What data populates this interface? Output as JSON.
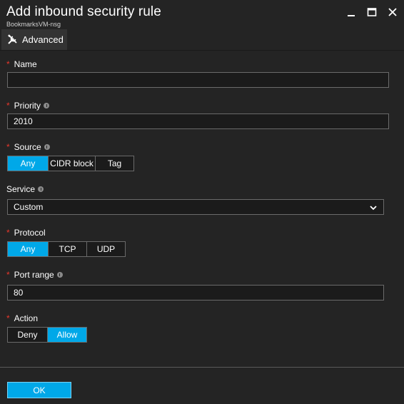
{
  "header": {
    "title": "Add inbound security rule",
    "subtitle": "BookmarksVM-nsg"
  },
  "toolbar": {
    "advanced_label": "Advanced"
  },
  "form": {
    "name": {
      "label": "Name",
      "value": ""
    },
    "priority": {
      "label": "Priority",
      "value": "2010"
    },
    "source": {
      "label": "Source",
      "options": [
        "Any",
        "CIDR block",
        "Tag"
      ],
      "selected": "Any"
    },
    "service": {
      "label": "Service",
      "value": "Custom"
    },
    "protocol": {
      "label": "Protocol",
      "options": [
        "Any",
        "TCP",
        "UDP"
      ],
      "selected": "Any"
    },
    "port_range": {
      "label": "Port range",
      "value": "80"
    },
    "action": {
      "label": "Action",
      "options": [
        "Deny",
        "Allow"
      ],
      "selected": "Allow"
    }
  },
  "footer": {
    "ok_label": "OK"
  },
  "colors": {
    "background": "#242424",
    "accent": "#00a8e8",
    "required": "#e8372c"
  }
}
